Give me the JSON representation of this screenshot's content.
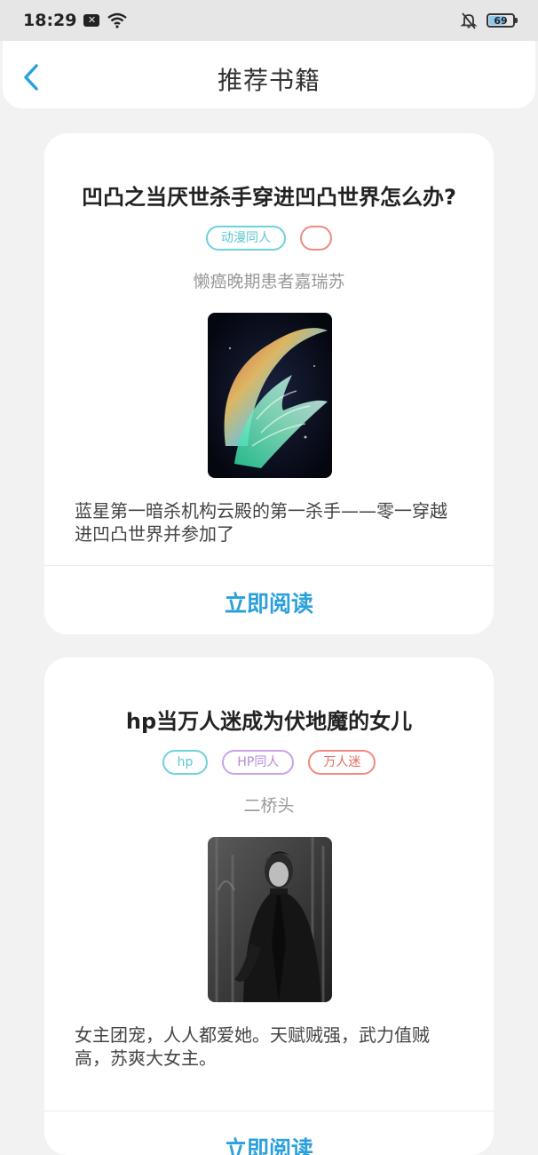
{
  "status_bar": {
    "time": "18:29",
    "battery": "69",
    "battery_level": 0.69
  },
  "header": {
    "title": "推荐书籍"
  },
  "books": [
    {
      "title": "凹凸之当厌世杀手穿进凹凸世界怎么办?",
      "tags": [
        {
          "label": "动漫同人",
          "color": "#5bc6d4"
        },
        {
          "label": "",
          "color": "#e46a5f"
        }
      ],
      "author": "懒癌晚期患者嘉瑞苏",
      "description": "蓝星第一暗杀机构云殿的第一杀手——零一穿越进凹凸世界并参加了",
      "read_label": "立即阅读"
    },
    {
      "title": "hp当万人迷成为伏地魔的女儿",
      "tags": [
        {
          "label": "hp",
          "color": "#5bc6d4"
        },
        {
          "label": "HP同人",
          "color": "#b28ad9"
        },
        {
          "label": "万人迷",
          "color": "#e46a5f"
        }
      ],
      "author": "二桥头",
      "description": "女主团宠，人人都爱她。天赋贼强，武力值贼高，苏爽大女主。",
      "read_label": "立即阅读"
    }
  ],
  "colors": {
    "accent": "#2ba0dc",
    "background": "#f2f2f2"
  }
}
